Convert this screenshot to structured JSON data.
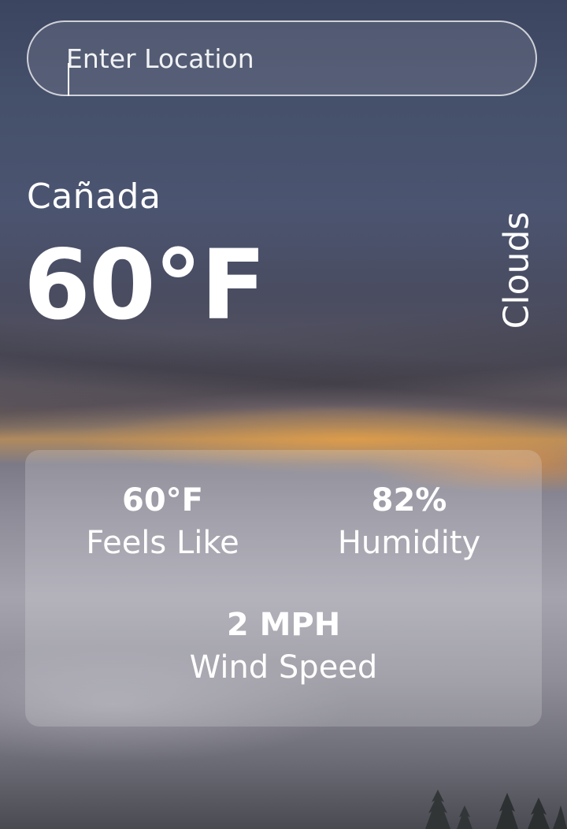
{
  "search": {
    "placeholder": "Enter Location",
    "value": ""
  },
  "weather": {
    "location": "Cañada",
    "temperature": "60°F",
    "condition": "Clouds"
  },
  "details": {
    "feels_like": {
      "value": "60°F",
      "label": "Feels Like"
    },
    "humidity": {
      "value": "82%",
      "label": "Humidity"
    },
    "wind_speed": {
      "value": "2 MPH",
      "label": "Wind Speed"
    }
  },
  "colors": {
    "text": "#ffffff",
    "search_border": "#e6e6eb",
    "card_background": "rgba(230,230,238,0.22)",
    "sunset_accent": "#f2a23c"
  },
  "icons": {
    "background": "sunset-sea-of-clouds-photo",
    "trees": "pine-trees-silhouette"
  }
}
